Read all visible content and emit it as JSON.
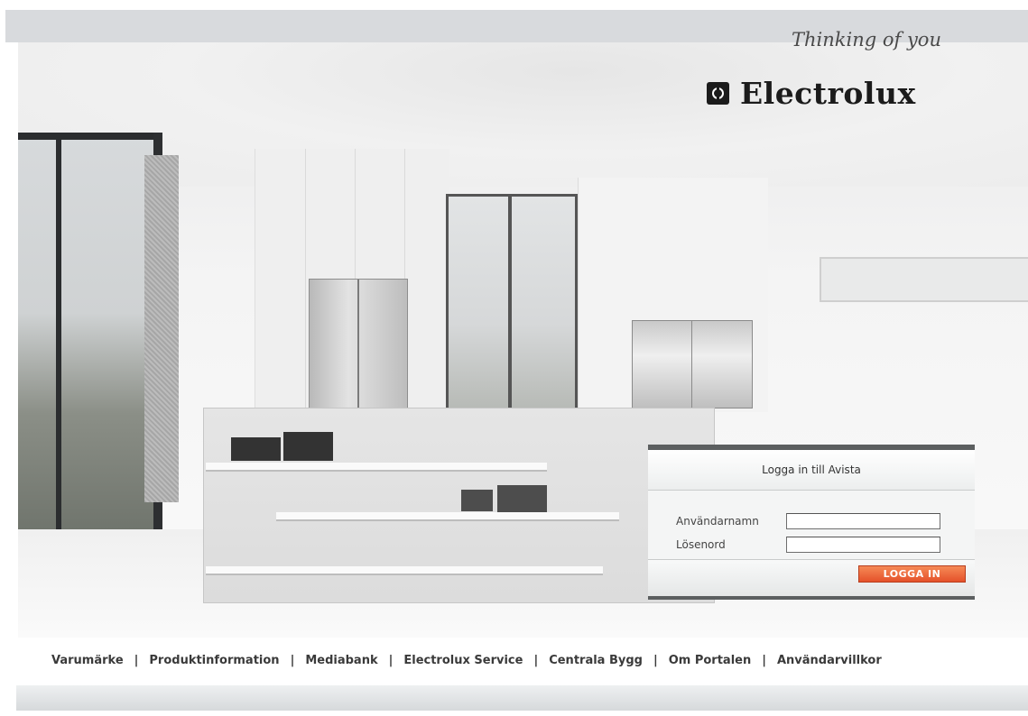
{
  "branding": {
    "tagline": "Thinking of you",
    "brand_name": "Electrolux",
    "logo_icon": "electrolux-logo-icon"
  },
  "login": {
    "title": "Logga in till Avista",
    "username_label": "Användarnamn",
    "username_value": "",
    "password_label": "Lösenord",
    "password_value": "",
    "submit_label": "LOGGA IN"
  },
  "footer_nav": {
    "items": [
      {
        "label": "Varumärke"
      },
      {
        "label": "Produktinformation"
      },
      {
        "label": "Mediabank"
      },
      {
        "label": "Electrolux Service"
      },
      {
        "label": "Centrala Bygg"
      },
      {
        "label": "Om Portalen"
      },
      {
        "label": "Användarvillkor"
      }
    ],
    "separator": "|"
  },
  "colors": {
    "accent_button": "#e5512a",
    "frame_border": "#5c5f60",
    "text": "#3a3a3a"
  }
}
